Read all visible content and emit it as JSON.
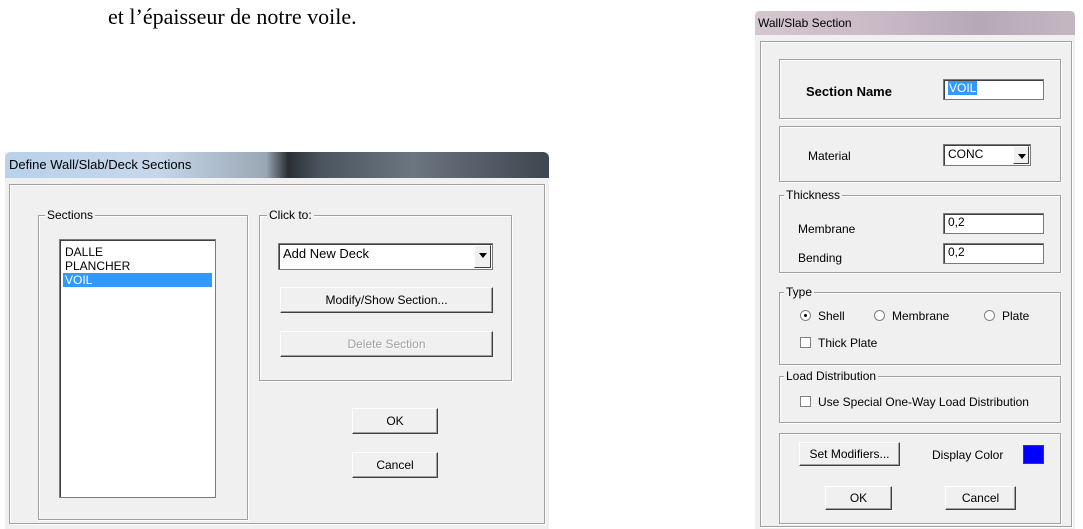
{
  "document": {
    "text": "et l’épaisseur de notre voile."
  },
  "define_dialog": {
    "title": "Define Wall/Slab/Deck Sections",
    "sections_label": "Sections",
    "sections": [
      "DALLE",
      "PLANCHER",
      "VOIL"
    ],
    "selected_section": "VOIL",
    "click_to_label": "Click to:",
    "action_select": "Add New Deck",
    "modify_button": "Modify/Show Section...",
    "delete_button": "Delete Section",
    "ok_button": "OK",
    "cancel_button": "Cancel"
  },
  "section_dialog": {
    "title": "Wall/Slab Section",
    "section_name_label": "Section Name",
    "section_name_value": "VOIL",
    "material_label": "Material",
    "material_value": "CONC",
    "thickness_label": "Thickness",
    "membrane_label": "Membrane",
    "membrane_value": "0,2",
    "bending_label": "Bending",
    "bending_value": "0,2",
    "type_label": "Type",
    "type_options": [
      "Shell",
      "Membrane",
      "Plate"
    ],
    "type_selected": "Shell",
    "thick_plate_label": "Thick Plate",
    "load_distribution_label": "Load Distribution",
    "special_one_way_label": "Use Special One-Way Load Distribution",
    "set_modifiers_button": "Set Modifiers...",
    "display_color_label": "Display Color",
    "display_color": "#0000ff",
    "ok_button": "OK",
    "cancel_button": "Cancel"
  }
}
